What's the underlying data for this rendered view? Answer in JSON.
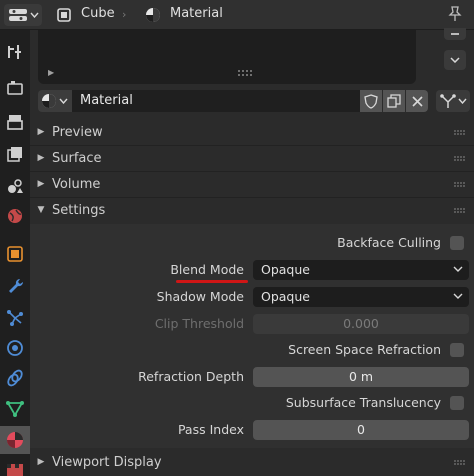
{
  "header": {
    "object_name": "Cube",
    "material_crumb": "Material"
  },
  "material_slot": {
    "name": "Material"
  },
  "panels": {
    "preview": "Preview",
    "surface": "Surface",
    "volume": "Volume",
    "settings": "Settings",
    "viewport_display": "Viewport Display"
  },
  "settings": {
    "backface_culling_label": "Backface Culling",
    "blend_mode_label": "Blend Mode",
    "blend_mode_value": "Opaque",
    "shadow_mode_label": "Shadow Mode",
    "shadow_mode_value": "Opaque",
    "clip_threshold_label": "Clip Threshold",
    "clip_threshold_value": "0.000",
    "screen_space_refraction_label": "Screen Space Refraction",
    "refraction_depth_label": "Refraction Depth",
    "refraction_depth_value": "0 m",
    "subsurface_translucency_label": "Subsurface Translucency",
    "pass_index_label": "Pass Index",
    "pass_index_value": "0"
  },
  "colors": {
    "highlight_underline": "#d01616",
    "background": "#2b2b2b"
  },
  "icons": {
    "tabs": [
      "tool-icon",
      "render-icon",
      "output-icon",
      "view-layer-icon",
      "scene-icon",
      "world-icon",
      "object-icon",
      "modifier-icon",
      "particles-icon",
      "physics-icon",
      "constraints-icon",
      "data-icon",
      "material-icon",
      "texture-icon"
    ]
  }
}
